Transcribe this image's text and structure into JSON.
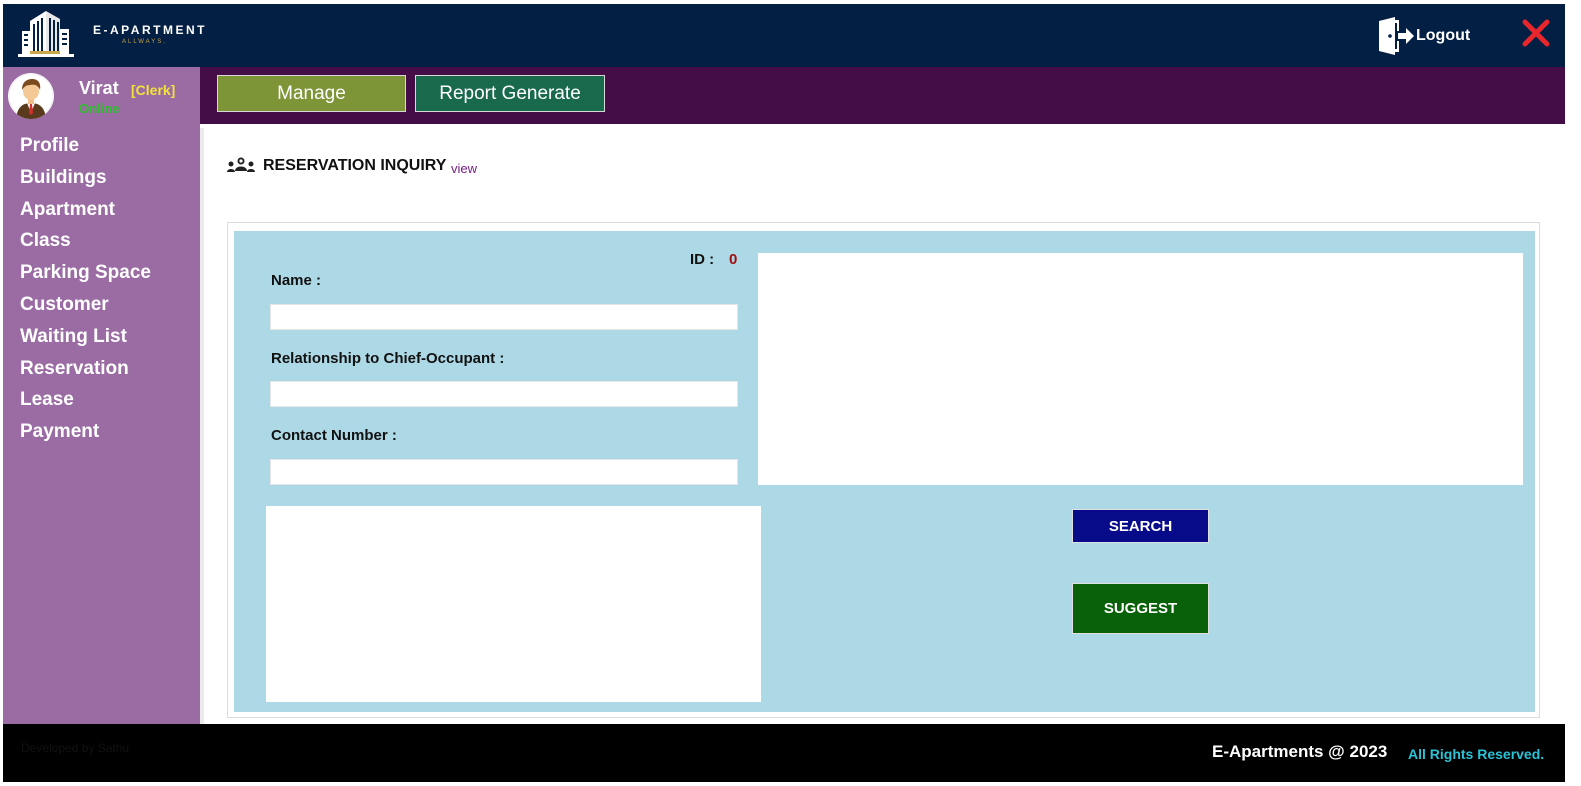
{
  "header": {
    "brand": "E-APARTMENT",
    "brand_sub": "ALLWAYS.",
    "logout_label": "Logout",
    "close_icon": "close-icon",
    "logo_icon": "building-logo-icon"
  },
  "user": {
    "name": "Virat",
    "role": "[Clerk]",
    "status": "Online",
    "avatar_icon": "avatar-icon"
  },
  "topnav": {
    "manage_label": "Manage",
    "report_label": "Report Generate"
  },
  "sidebar": {
    "items": [
      {
        "label": "Profile"
      },
      {
        "label": "Buildings"
      },
      {
        "label": "Apartment"
      },
      {
        "label": "Class"
      },
      {
        "label": "Parking Space"
      },
      {
        "label": "Customer"
      },
      {
        "label": "Waiting List"
      },
      {
        "label": "Reservation"
      },
      {
        "label": "Lease"
      },
      {
        "label": "Payment"
      }
    ]
  },
  "page": {
    "title": "RESERVATION INQUIRY",
    "view_link": "view",
    "title_icon": "people-group-icon"
  },
  "form": {
    "id_label": "ID :",
    "id_value": "0",
    "name_label": "Name :",
    "name_value": "",
    "relationship_label": "Relationship to Chief-Occupant :",
    "relationship_value": "",
    "contact_label": "Contact Number :",
    "contact_value": "",
    "search_label": "SEARCH",
    "suggest_label": "SUGGEST"
  },
  "footer": {
    "developer": "Developed by Sathu",
    "copyright": "E-Apartments @ 2023",
    "rights": "All Rights Reserved."
  },
  "colors": {
    "header_bg": "#041f44",
    "sidebar_bg": "#9a6ca3",
    "topnav_bg": "#450d48",
    "manage_btn": "#7d9437",
    "report_btn": "#196a4d",
    "panel_bg": "#add8e6",
    "search_btn": "#070b8a",
    "suggest_btn": "#086008",
    "close_red": "#e8262c"
  }
}
